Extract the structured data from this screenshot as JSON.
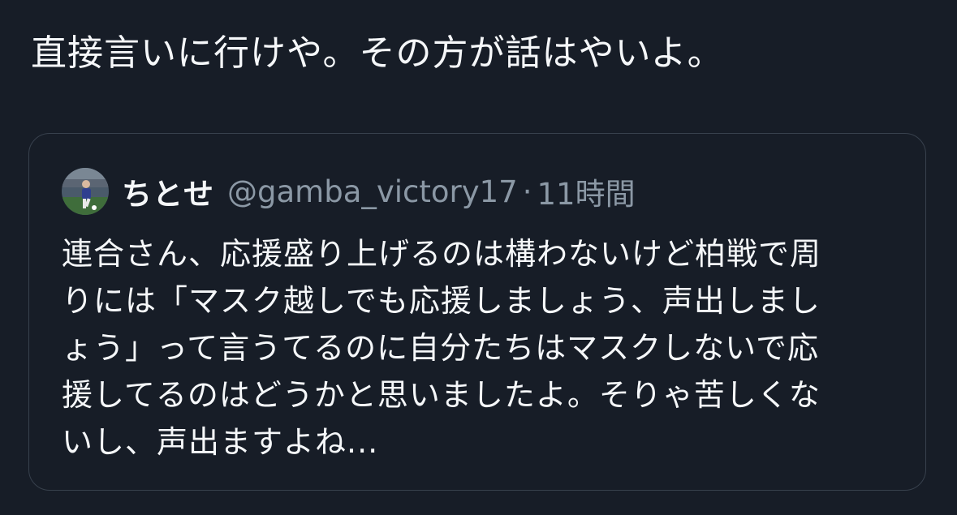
{
  "tweet": {
    "text": "直接言いに行けや。その方が話はやいよ。"
  },
  "quoted_tweet": {
    "display_name": "ちとせ",
    "handle": "@gamba_victory17",
    "separator": "·",
    "time": "11時間",
    "avatar_icon": "user-avatar-icon",
    "body_lines": [
      "連合さん、応援盛り上げるのは構わないけど柏戦で周",
      "りには「マスク越しでも応援しましょう、声出しまし",
      "ょう」って言うてるのに自分たちはマスクしないで応",
      "援してるのはどうかと思いましたよ。そりゃ苦しくな",
      "いし、声出ますよね..."
    ]
  },
  "colors": {
    "background": "#171d27",
    "text_primary": "#f5f7f9",
    "text_secondary": "#8b98a5",
    "border": "#38414d"
  }
}
